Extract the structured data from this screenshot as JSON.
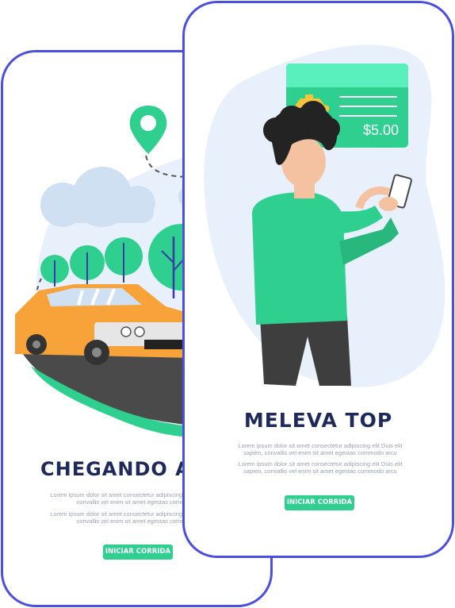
{
  "screens": [
    {
      "title": "CHEGANDO AO",
      "paragraph_1": "Lorem ipsum dolor sit amet consectetur adipiscing elit Duis elit sapien, convallis vel enim sit amet egestas commodo arcu",
      "paragraph_2": "Lorem ipsum dolor sit amet consectetur adipiscing elit Duis elit sapien, convallis vel enim sit amet egestas commodo arcu",
      "button_label": "INICIAR CORRIDA"
    },
    {
      "title": "MELEVA TOP",
      "price": "$5.00",
      "paragraph_1": "Lorem ipsum dolor sit amet consectetur adipiscing elit Duis elit sapien, convallis vel enim sit amet egestas commodo arcu",
      "paragraph_2": "Lorem ipsum dolor sit amet consectetur adipiscing elit Duis elit sapien, convallis vel enim sit amet egestas commodo arcu",
      "button_label": "INICIAR CORRIDA"
    }
  ],
  "colors": {
    "frame": "#4a4fe0",
    "accent": "#2ecf8f",
    "title": "#1f2a5c",
    "car": "#f7a33a",
    "blob": "#e8f1fb"
  },
  "icons": [
    "map-pin-icon",
    "taxi-icon"
  ]
}
